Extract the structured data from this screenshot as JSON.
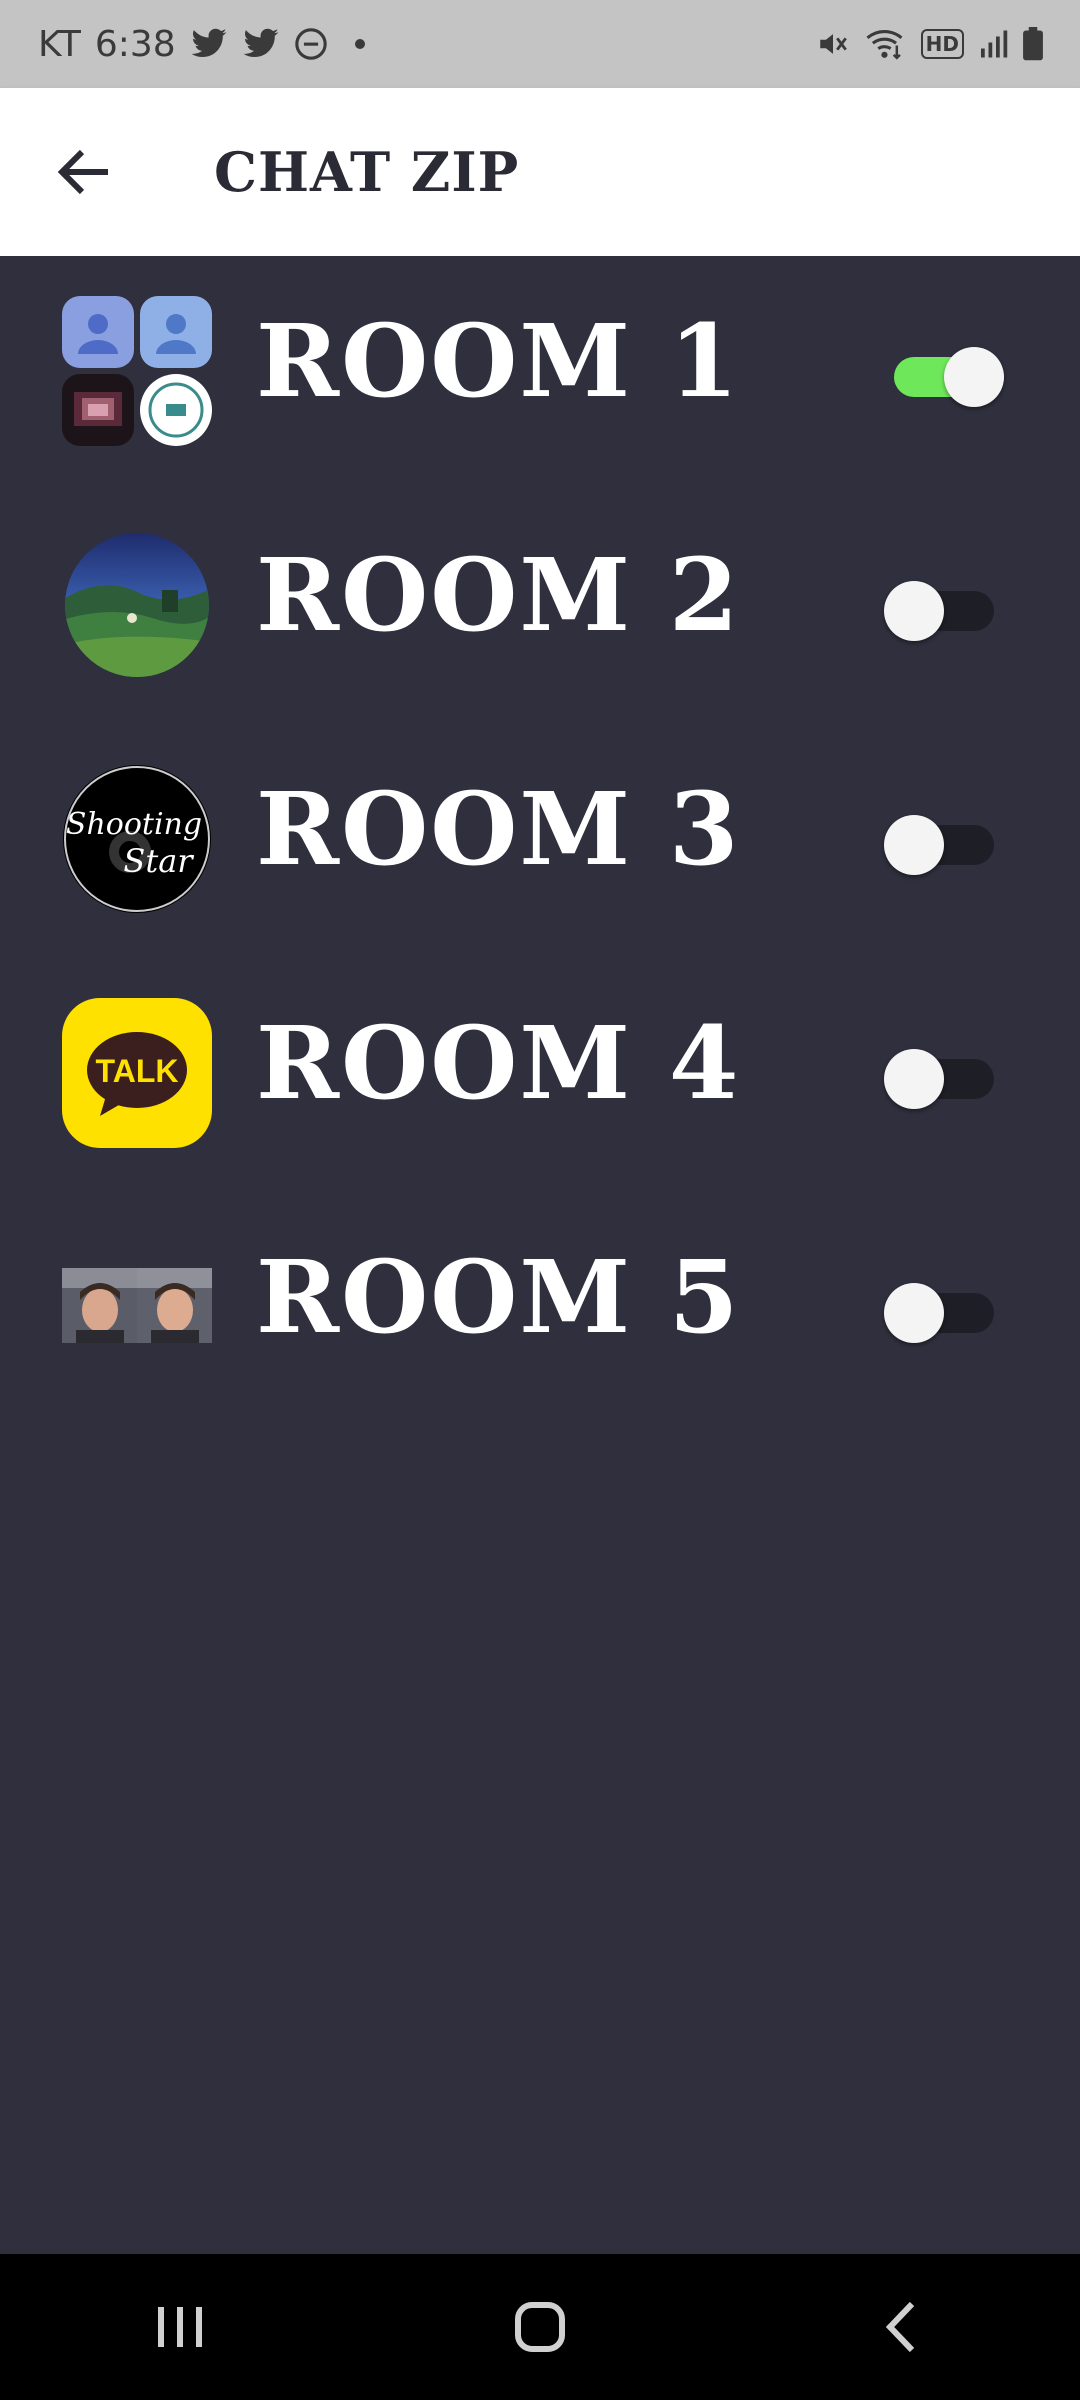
{
  "status_bar": {
    "carrier": "KT",
    "time": "6:38",
    "left_icons": [
      "twitter-icon",
      "twitter-icon",
      "do-not-disturb-icon",
      "dot-icon"
    ],
    "right_icons": [
      "mute-icon",
      "wifi-icon",
      "hd-icon",
      "signal-icon",
      "battery-icon"
    ],
    "hd_label": "HD"
  },
  "app_bar": {
    "title": "CHAT ZIP",
    "back_icon": "arrow-left-icon"
  },
  "rooms": [
    {
      "name": "ROOM 1",
      "avatar": "group-grid-avatar",
      "enabled": true
    },
    {
      "name": "ROOM 2",
      "avatar": "landscape-avatar",
      "enabled": false
    },
    {
      "name": "ROOM 3",
      "avatar": "shooting-star-avatar",
      "avatar_text_1": "Shooting",
      "avatar_text_2": "Star",
      "enabled": false
    },
    {
      "name": "ROOM 4",
      "avatar": "kakaotalk-avatar",
      "avatar_text": "TALK",
      "enabled": false
    },
    {
      "name": "ROOM 5",
      "avatar": "two-faces-avatar",
      "enabled": false
    }
  ],
  "colors": {
    "background": "#2f2f3d",
    "app_bar": "#ffffff",
    "toggle_on": "#6ee85a",
    "toggle_off": "#1e1e26",
    "status_bar": "#c4c4c4",
    "nav_bar": "#000000"
  },
  "nav_bar": {
    "icons": [
      "recent-apps-icon",
      "home-icon",
      "back-icon"
    ]
  }
}
